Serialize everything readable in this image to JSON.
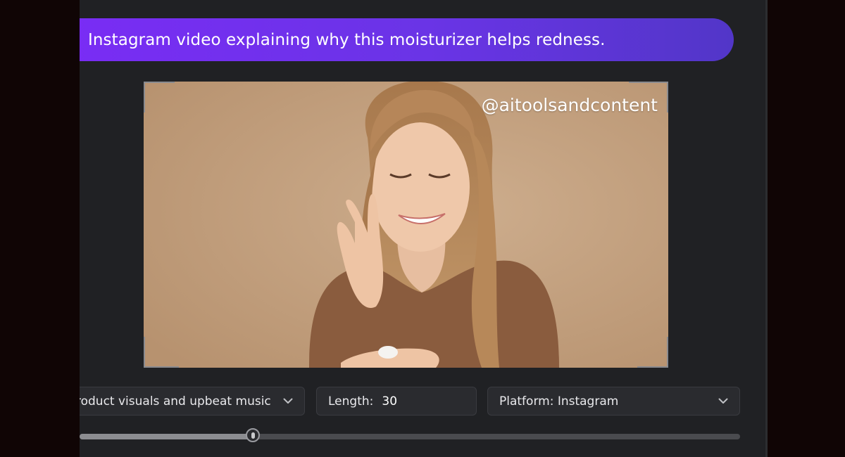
{
  "prompt": {
    "text": "Instagram video explaining why this moisturizer helps redness."
  },
  "video": {
    "watermark": "@aitoolsandcontent"
  },
  "controls": {
    "style_value": "roduct visuals and upbeat music",
    "length_label": "Length:",
    "length_value": "30",
    "platform_value": "Platform: Instagram"
  },
  "timeline": {
    "position_fraction": 0.262
  },
  "icons": {
    "style_dropdown": "chevron-down-icon",
    "platform_dropdown": "chevron-down-icon"
  },
  "colors": {
    "prompt_gradient_start": "#7a2cf5",
    "prompt_gradient_end": "#5236c8",
    "panel_bg": "#202124",
    "control_bg": "#2a2b2f"
  }
}
